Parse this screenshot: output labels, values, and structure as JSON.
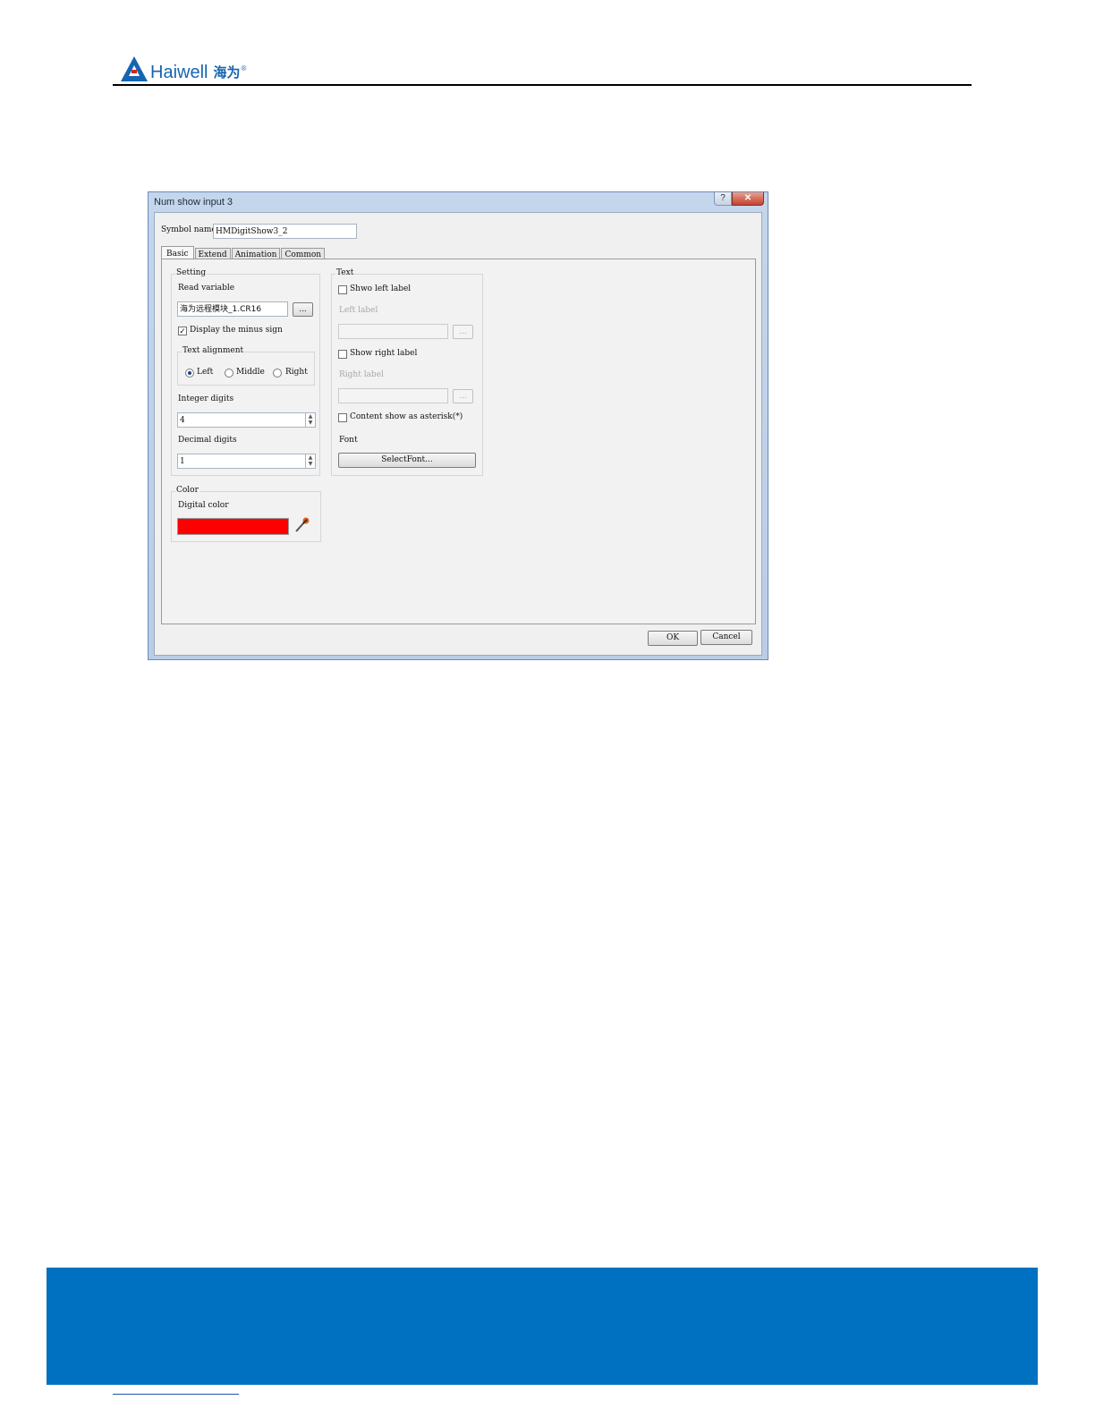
{
  "brand": {
    "name": "Haiwell",
    "cn": "海为",
    "reg": "®",
    "mark_color": "#1565b0"
  },
  "dialog": {
    "title": "Num show input 3",
    "help": "?",
    "close": "✕",
    "symbol_name_label": "Symbol name",
    "symbol_name_value": "HMDigitShow3_2",
    "tabs": [
      "Basic",
      "Extend",
      "Animation",
      "Common"
    ],
    "active_tab": "Basic",
    "setting": {
      "title": "Setting",
      "read_variable_label": "Read variable",
      "read_variable_value": "海为远程模块_1.CR16",
      "browse": "...",
      "minus_sign_label": "Display the minus sign",
      "minus_sign_checked": true,
      "alignment_title": "Text alignment",
      "alignment_options": [
        "Left",
        "Middle",
        "Right"
      ],
      "alignment_selected": "Left",
      "integer_digits_label": "Integer digits",
      "integer_digits_value": "4",
      "decimal_digits_label": "Decimal digits",
      "decimal_digits_value": "1"
    },
    "text": {
      "title": "Text",
      "show_left_label": "Shwo left label",
      "left_label_caption": "Left label",
      "browse": "...",
      "show_right_label": "Show right label",
      "right_label_caption": "Right label",
      "asterisk_label": "Content show as asterisk(*)",
      "font_label": "Font",
      "select_font_button": "SelectFont..."
    },
    "color": {
      "title": "Color",
      "digital_color_label": "Digital color",
      "digital_color_value": "#ff0000"
    },
    "ok": "OK",
    "cancel": "Cancel"
  },
  "footer": {
    "band_color": "#0070c0"
  }
}
